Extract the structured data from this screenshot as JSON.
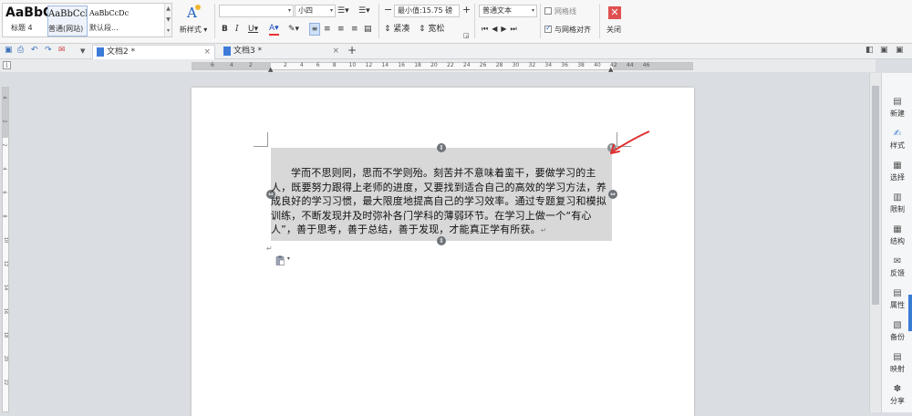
{
  "ribbon": {
    "styles": [
      {
        "sample": "AaBbC",
        "name": "标题 4"
      },
      {
        "sample": "AaBbCcI",
        "name": "普通(网站)"
      },
      {
        "sample": "AaBbCcDc",
        "name": "默认段..."
      }
    ],
    "new_style_label": "新样式",
    "font_name": "",
    "font_size": "小四",
    "bold": "B",
    "italic": "I",
    "underline": "U",
    "font_color": "A",
    "line_spacing_min": "最小值:15.75 磅",
    "compact_label": "紧凑",
    "loose_label": "宽松",
    "text_type": "普通文本",
    "gridlines_label": "网格线",
    "snap_grid_label": "与网格对齐",
    "close_label": "关闭",
    "minus": "−",
    "plus": "+"
  },
  "tabs": [
    {
      "label": "文档2 *",
      "close": "×"
    },
    {
      "label": "文档3 *",
      "close": "×"
    }
  ],
  "new_tab": "+",
  "hruler_numbers": [
    "6",
    "4",
    "2",
    "2",
    "4",
    "6",
    "8",
    "10",
    "12",
    "14",
    "16",
    "18",
    "20",
    "22",
    "24",
    "26",
    "28",
    "30",
    "32",
    "34",
    "36",
    "38",
    "40",
    "42",
    "44",
    "46"
  ],
  "vruler_numbers": [
    "4",
    "2",
    "2",
    "4",
    "6",
    "8",
    "10",
    "12",
    "14",
    "16",
    "18",
    "20",
    "22"
  ],
  "document": {
    "paragraph": "学而不思则罔，思而不学则殆。刻苦并不意味着蛮干，要做学习的主人，既要努力跟得上老师的进度，又要找到适合自己的高效的学习方法，养成良好的学习习惯，最大限度地提高自己的学习效率。通过专题复习和模拟训练，不断发现并及时弥补各门学科的薄弱环节。在学习上做一个“有心人”，善于思考，善于总结，善于发现，才能真正学有所获。",
    "para_end": "↵"
  },
  "sidebar": [
    {
      "label": "新建",
      "icon": "new-doc-icon"
    },
    {
      "label": "样式",
      "icon": "style-icon"
    },
    {
      "label": "选择",
      "icon": "select-icon"
    },
    {
      "label": "限制",
      "icon": "restrict-icon"
    },
    {
      "label": "结构",
      "icon": "structure-icon"
    },
    {
      "label": "反馈",
      "icon": "feedback-icon"
    },
    {
      "label": "属性",
      "icon": "properties-icon"
    },
    {
      "label": "备份",
      "icon": "backup-icon"
    },
    {
      "label": "映射",
      "icon": "mapping-icon"
    },
    {
      "label": "分享",
      "icon": "share-icon"
    }
  ],
  "colors": {
    "accent": "#3a7bd5",
    "close_red": "#e05050",
    "annotation_red": "#e03030",
    "selection_grey": "#d8d8d8"
  }
}
